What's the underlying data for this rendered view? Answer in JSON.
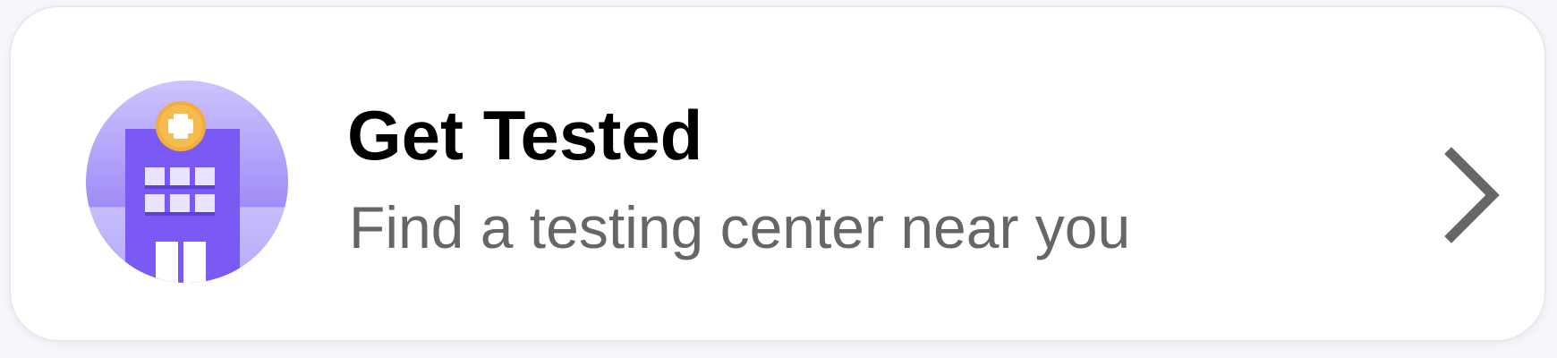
{
  "card": {
    "title": "Get Tested",
    "subtitle": "Find a testing center near you",
    "icon": "hospital-building-icon",
    "action_icon": "chevron-right-icon"
  },
  "colors": {
    "background": "#ffffff",
    "title": "#000000",
    "subtitle": "#666666",
    "chevron": "#666666",
    "circle_light": "#c9befc",
    "circle_mid": "#a997fa",
    "building": "#7b5cf5",
    "cross_badge": "#f4b13f"
  }
}
